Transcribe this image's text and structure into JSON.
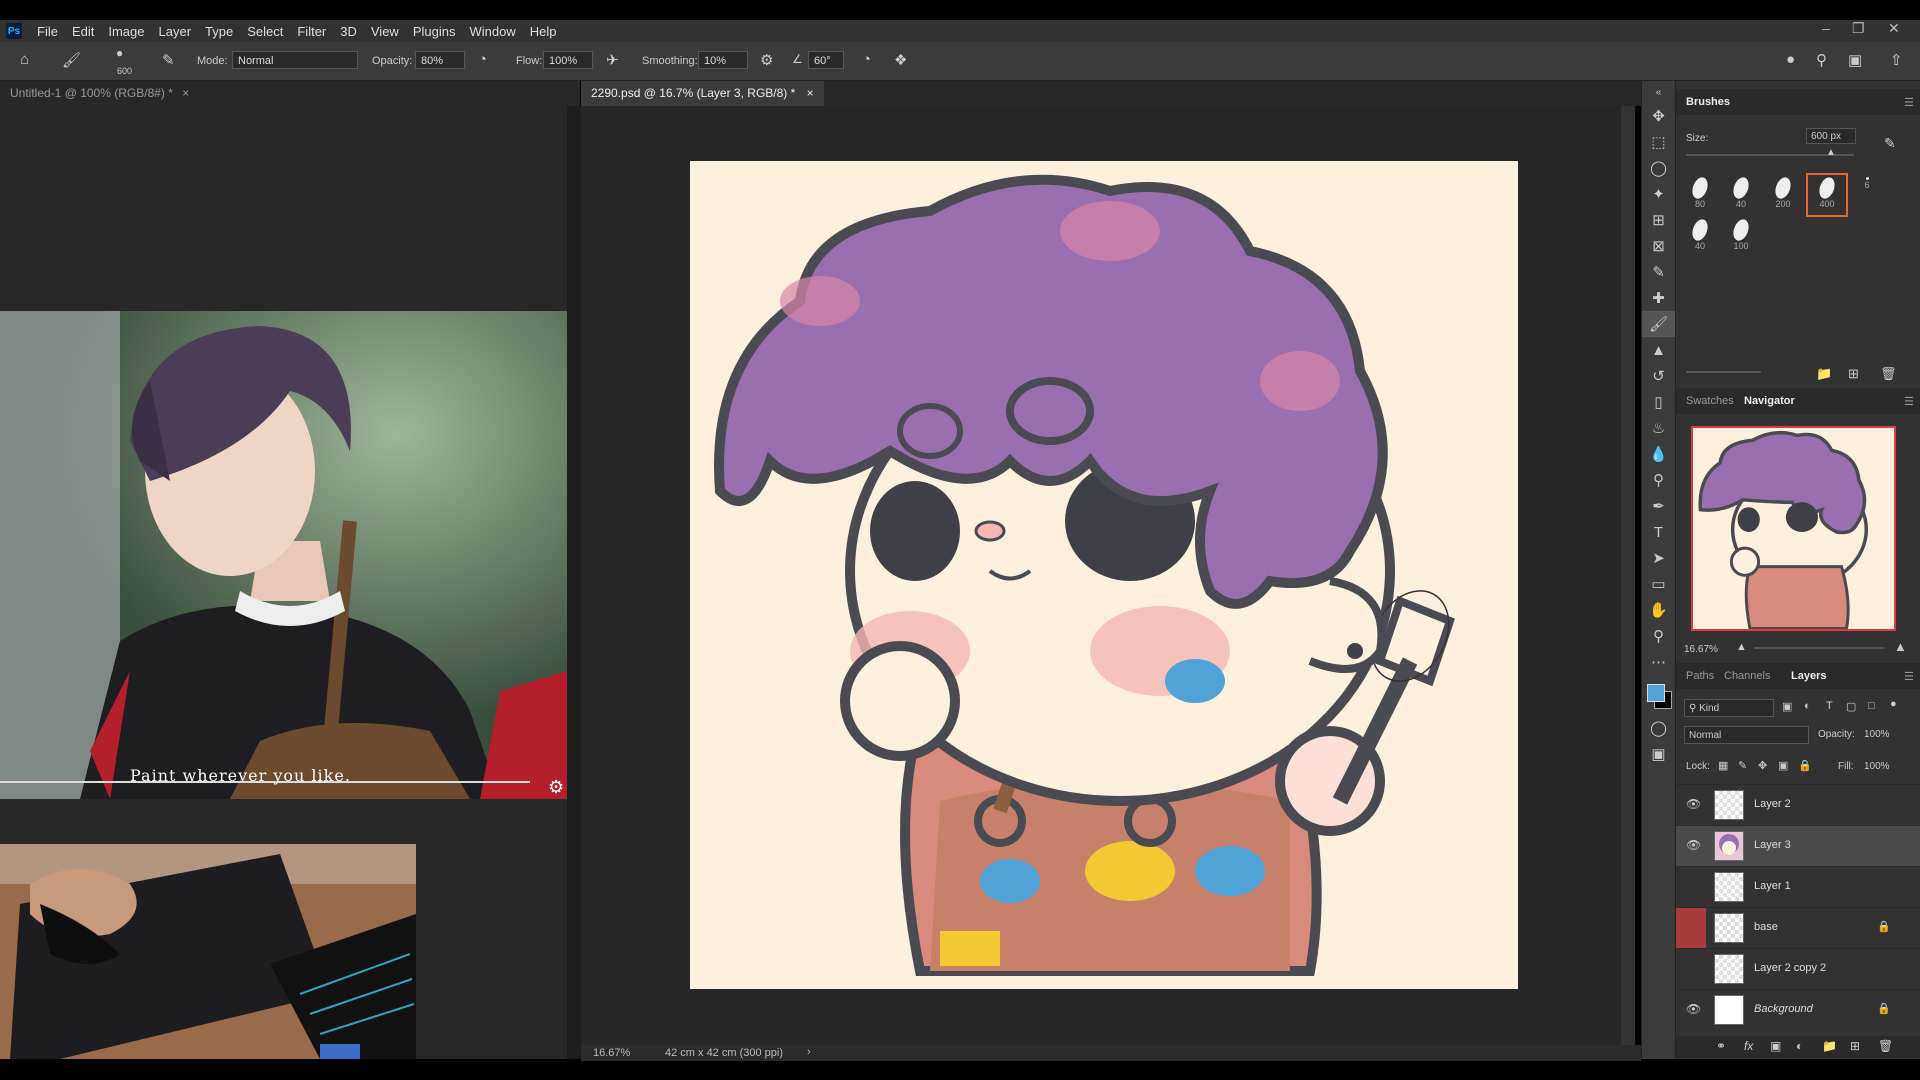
{
  "menu": {
    "app_icon": "Ps",
    "items": [
      "File",
      "Edit",
      "Image",
      "Layer",
      "Type",
      "Select",
      "Filter",
      "3D",
      "View",
      "Plugins",
      "Window",
      "Help"
    ]
  },
  "options": {
    "brush_size": "600",
    "mode_label": "Mode:",
    "mode_value": "Normal",
    "opacity_label": "Opacity:",
    "opacity_value": "80%",
    "flow_label": "Flow:",
    "flow_value": "100%",
    "smoothing_label": "Smoothing:",
    "smoothing_value": "10%",
    "angle_value": "60°"
  },
  "tabs": {
    "left_doc": "Untitled-1 @ 100% (RGB/8#) *",
    "main_doc": "2290.psd @ 16.7% (Layer 3, RGB/8) *"
  },
  "video": {
    "subtitle": "Paint wherever you like."
  },
  "status": {
    "zoom": "16.67%",
    "doc_size": "42 cm x 42 cm (300 ppi)"
  },
  "brushes": {
    "title": "Brushes",
    "size_label": "Size:",
    "size_value": "600 px",
    "presets": [
      "80",
      "40",
      "200",
      "400",
      "6",
      "40",
      "100"
    ]
  },
  "navigator": {
    "tabs": [
      "Swatches",
      "Navigator"
    ],
    "zoom": "16.67%"
  },
  "layers": {
    "tabs": [
      "Paths",
      "Channels",
      "Layers"
    ],
    "filter_value": "Kind",
    "blend_value": "Normal",
    "opacity_label": "Opacity:",
    "opacity_value": "100%",
    "lock_label": "Lock:",
    "fill_label": "Fill:",
    "fill_value": "100%",
    "items": [
      {
        "name": "Layer 2"
      },
      {
        "name": "Layer 3"
      },
      {
        "name": "Layer 1"
      },
      {
        "name": "base"
      },
      {
        "name": "Layer 2 copy 2"
      },
      {
        "name": "Background"
      }
    ]
  },
  "colors": {
    "foreground": "#4fa3d9",
    "background": "#000000",
    "canvas": "#fdf0dc",
    "hair": "#9a6fb0",
    "outline": "#4a4a52"
  }
}
